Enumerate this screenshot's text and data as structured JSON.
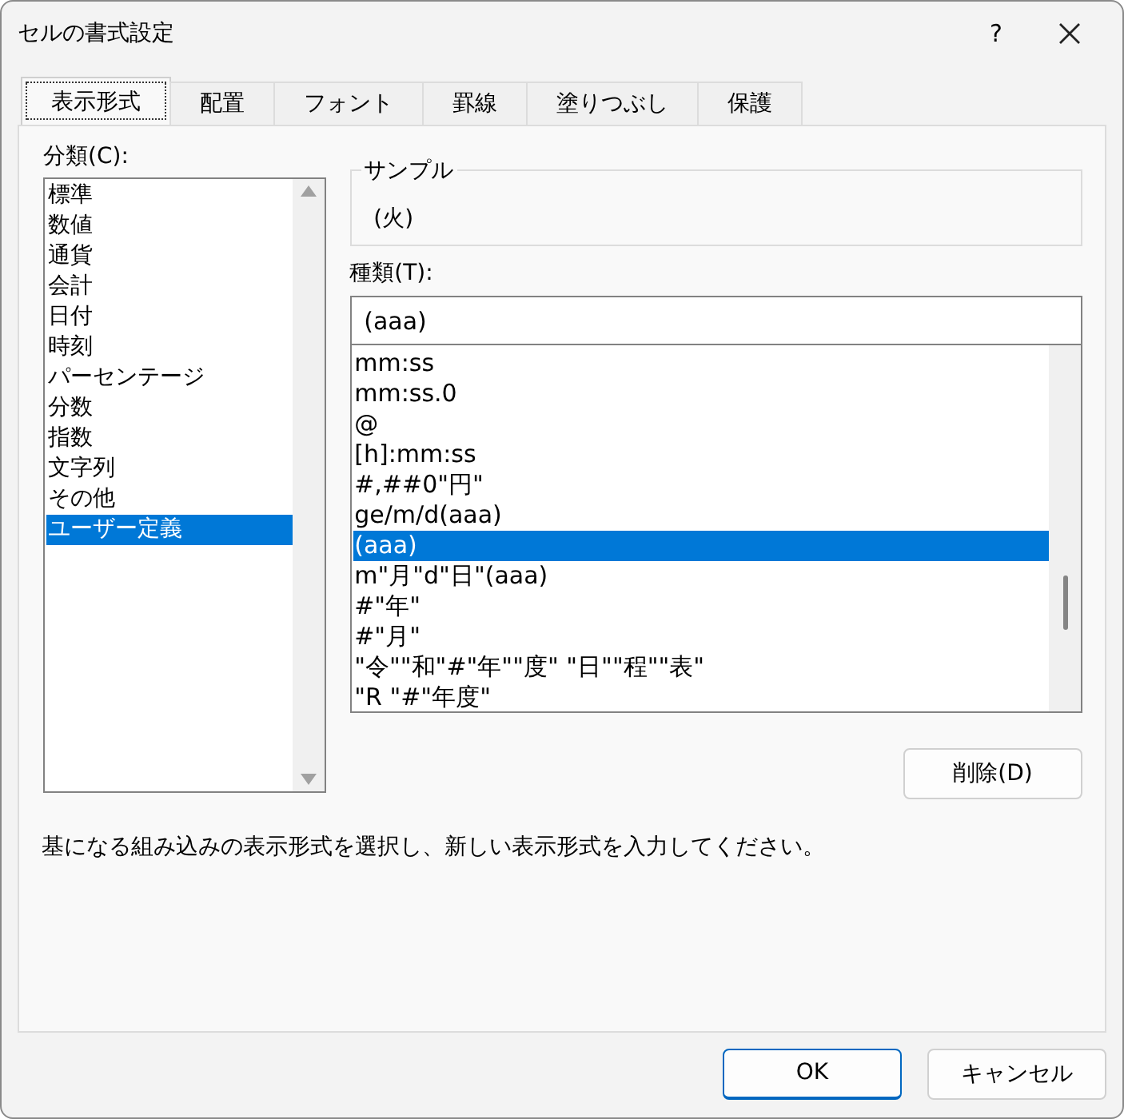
{
  "window": {
    "title": "セルの書式設定",
    "help": "?"
  },
  "tabs": [
    {
      "label": "表示形式",
      "selected": true
    },
    {
      "label": "配置",
      "selected": false
    },
    {
      "label": "フォント",
      "selected": false
    },
    {
      "label": "罫線",
      "selected": false
    },
    {
      "label": "塗りつぶし",
      "selected": false
    },
    {
      "label": "保護",
      "selected": false
    }
  ],
  "category": {
    "label": "分類(C):",
    "items": [
      {
        "label": "標準",
        "selected": false
      },
      {
        "label": "数値",
        "selected": false
      },
      {
        "label": "通貨",
        "selected": false
      },
      {
        "label": "会計",
        "selected": false
      },
      {
        "label": "日付",
        "selected": false
      },
      {
        "label": "時刻",
        "selected": false
      },
      {
        "label": "パーセンテージ",
        "selected": false
      },
      {
        "label": "分数",
        "selected": false
      },
      {
        "label": "指数",
        "selected": false
      },
      {
        "label": "文字列",
        "selected": false
      },
      {
        "label": "その他",
        "selected": false
      },
      {
        "label": "ユーザー定義",
        "selected": true
      }
    ]
  },
  "sample": {
    "label": "サンプル",
    "value": "(火)"
  },
  "type": {
    "label": "種類(T):",
    "value": "(aaa)",
    "items": [
      {
        "label": "mm:ss",
        "selected": false
      },
      {
        "label": "mm:ss.0",
        "selected": false
      },
      {
        "label": "@",
        "selected": false
      },
      {
        "label": "[h]:mm:ss",
        "selected": false
      },
      {
        "label": "#,##0\"円\"",
        "selected": false
      },
      {
        "label": "ge/m/d(aaa)",
        "selected": false
      },
      {
        "label": "(aaa)",
        "selected": true
      },
      {
        "label": "m\"月\"d\"日\"(aaa)",
        "selected": false
      },
      {
        "label": "#\"年\"",
        "selected": false
      },
      {
        "label": "#\"月\"",
        "selected": false
      },
      {
        "label": "\"令\"\"和\"#\"年\"\"度\" \"日\"\"程\"\"表\"",
        "selected": false
      },
      {
        "label": "\"R \"#\"年度\"",
        "selected": false
      }
    ]
  },
  "delete_button": "削除(D)",
  "description": "基になる組み込みの表示形式を選択し、新しい表示形式を入力してください。",
  "buttons": [
    {
      "label": "OK",
      "kind": "default"
    },
    {
      "label": "キャンセル",
      "kind": "normal"
    }
  ]
}
